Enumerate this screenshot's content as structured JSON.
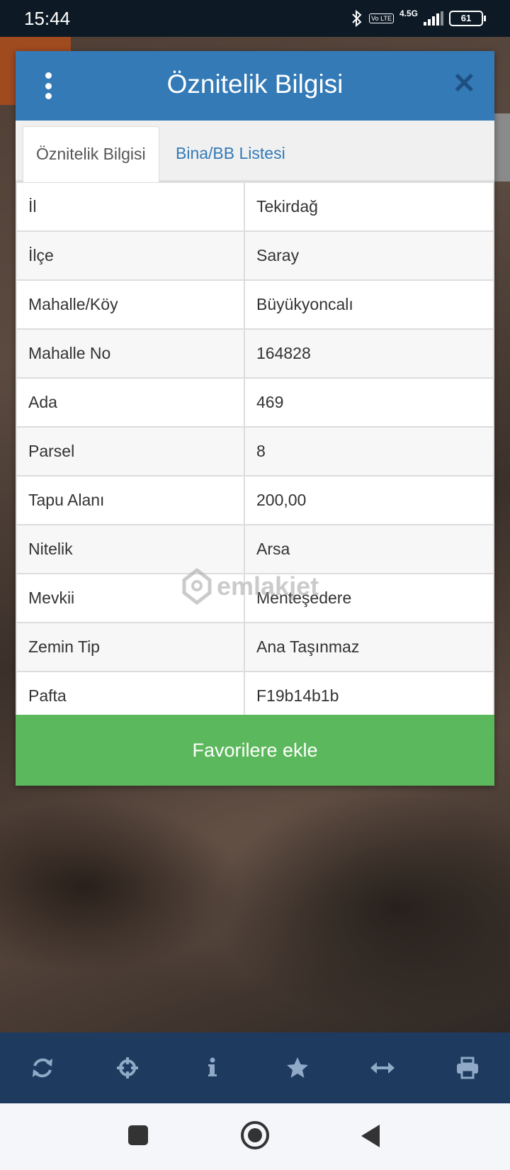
{
  "status_bar": {
    "time": "15:44",
    "network": "4.5G",
    "volte": "Vo LTE",
    "battery": "61"
  },
  "dialog": {
    "title": "Öznitelik Bilgisi",
    "tabs": [
      {
        "label": "Öznitelik Bilgisi",
        "active": true
      },
      {
        "label": "Bina/BB Listesi",
        "active": false
      }
    ],
    "rows": [
      {
        "key": "İl",
        "value": "Tekirdağ"
      },
      {
        "key": "İlçe",
        "value": "Saray"
      },
      {
        "key": "Mahalle/Köy",
        "value": "Büyükyoncalı"
      },
      {
        "key": "Mahalle No",
        "value": "164828"
      },
      {
        "key": "Ada",
        "value": "469"
      },
      {
        "key": "Parsel",
        "value": "8"
      },
      {
        "key": "Tapu Alanı",
        "value": "200,00"
      },
      {
        "key": "Nitelik",
        "value": "Arsa"
      },
      {
        "key": "Mevkii",
        "value": "Menteşedere"
      },
      {
        "key": "Zemin Tip",
        "value": "Ana Taşınmaz"
      },
      {
        "key": "Pafta",
        "value": "F19b14b1b"
      }
    ],
    "favorite_button": "Favorilere ekle"
  },
  "watermark": "emlakjet",
  "toolbar": {
    "items": [
      "refresh-icon",
      "crosshair-icon",
      "info-icon",
      "star-icon",
      "measure-icon",
      "print-icon"
    ]
  },
  "colors": {
    "header": "#337ab7",
    "favorite": "#5cb85c",
    "toolbar": "#1e3a5f"
  }
}
